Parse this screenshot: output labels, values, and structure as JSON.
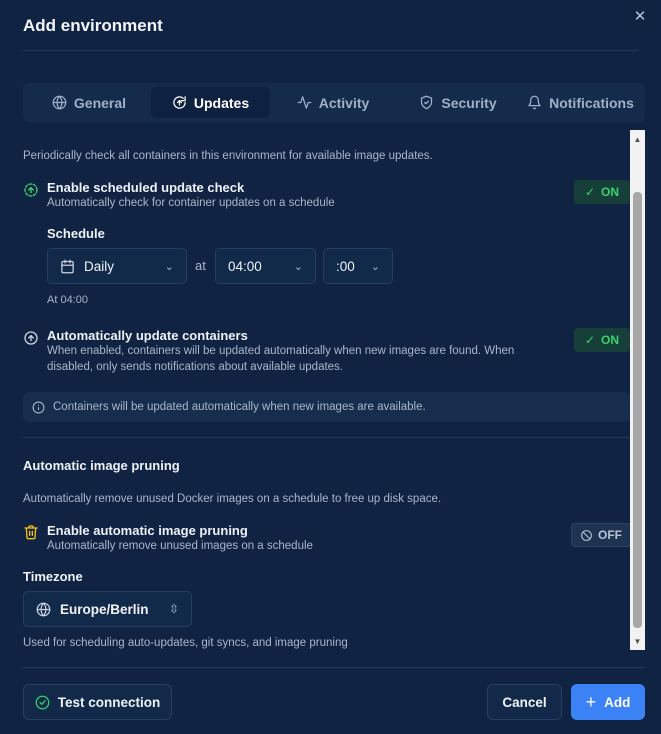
{
  "modal": {
    "title": "Add environment",
    "close_icon": "close-icon"
  },
  "tabs": [
    {
      "label": "General",
      "icon": "globe-icon",
      "active": false
    },
    {
      "label": "Updates",
      "icon": "refresh-icon",
      "active": true
    },
    {
      "label": "Activity",
      "icon": "activity-icon",
      "active": false
    },
    {
      "label": "Security",
      "icon": "shield-icon",
      "active": false
    },
    {
      "label": "Notifications",
      "icon": "bell-icon",
      "active": false
    }
  ],
  "updates": {
    "intro": "Periodically check all containers in this environment for available image updates.",
    "scheduled_check": {
      "title": "Enable scheduled update check",
      "description": "Automatically check for container updates on a schedule",
      "state": "ON"
    },
    "schedule": {
      "label": "Schedule",
      "frequency": "Daily",
      "at_label": "at",
      "hour": "04:00",
      "minute": ":00",
      "summary": "At 04:00"
    },
    "auto_update": {
      "title": "Automatically update containers",
      "description": "When enabled, containers will be updated automatically when new images are found. When disabled, only sends notifications about available updates.",
      "state": "ON"
    },
    "info": "Containers will be updated automatically when new images are available."
  },
  "pruning": {
    "heading": "Automatic image pruning",
    "intro": "Automatically remove unused Docker images on a schedule to free up disk space.",
    "enable": {
      "title": "Enable automatic image pruning",
      "description": "Automatically remove unused images on a schedule",
      "state": "OFF"
    }
  },
  "timezone": {
    "label": "Timezone",
    "value": "Europe/Berlin",
    "help": "Used for scheduling auto-updates, git syncs, and image pruning"
  },
  "footer": {
    "test_connection": "Test connection",
    "cancel": "Cancel",
    "add": "Add"
  },
  "colors": {
    "accent": "#3b82f6",
    "on_green": "#37d36a",
    "warning_yellow": "#f5c518"
  }
}
